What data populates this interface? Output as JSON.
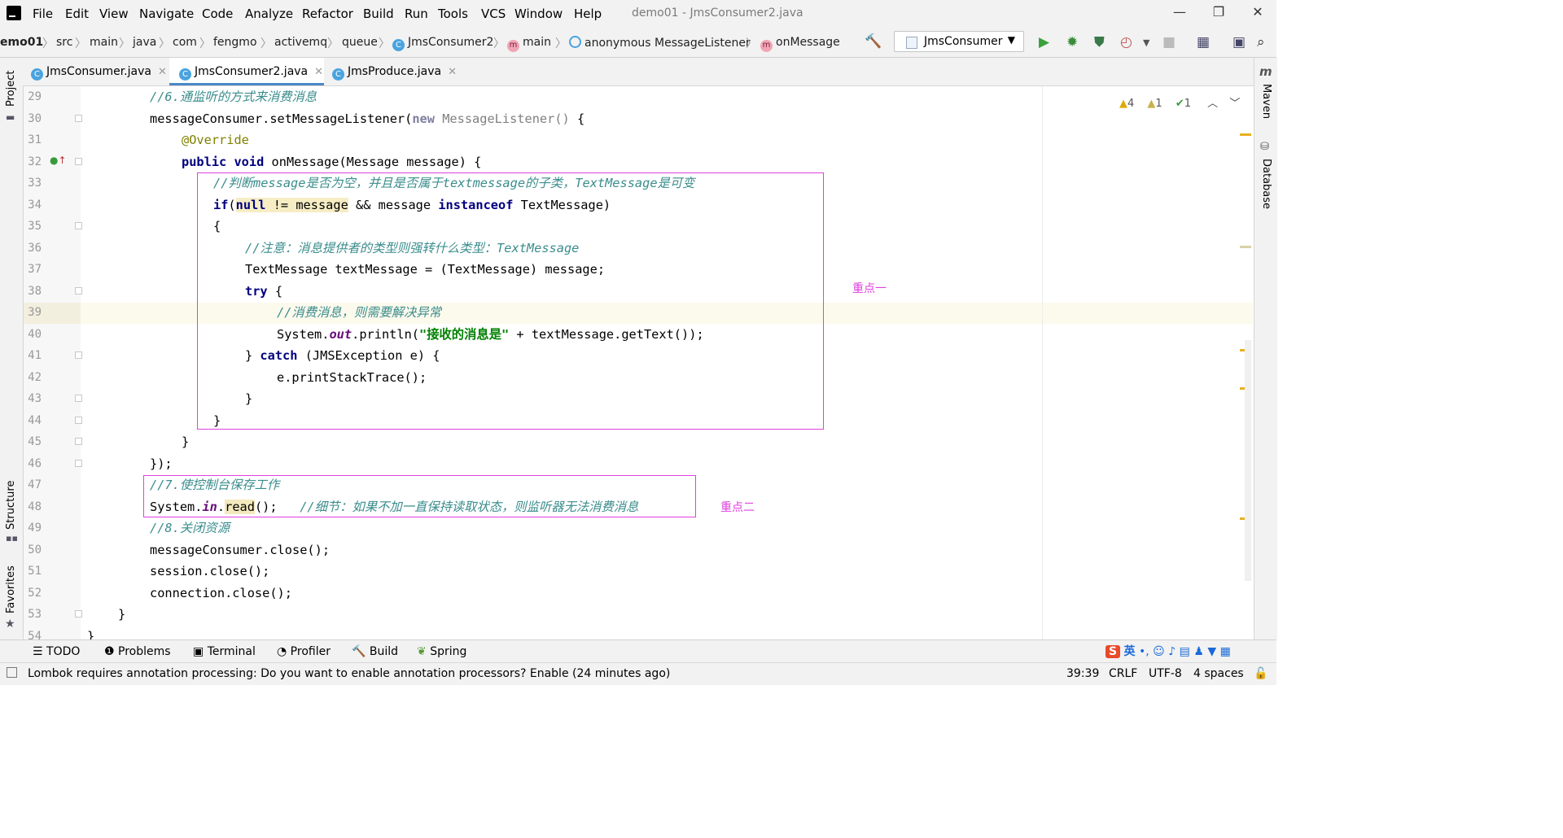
{
  "menu": [
    "File",
    "Edit",
    "View",
    "Navigate",
    "Code",
    "Analyze",
    "Refactor",
    "Build",
    "Run",
    "Tools",
    "VCS",
    "Window",
    "Help"
  ],
  "window_title": "demo01 - JmsConsumer2.java",
  "window_controls": {
    "minimize": "—",
    "maximize": "❐",
    "close": "✕"
  },
  "breadcrumbs": {
    "project": "emo01",
    "src": "src",
    "main": "main",
    "java": "java",
    "com": "com",
    "fengmo": "fengmo",
    "activemq": "activemq",
    "queue": "queue",
    "class": "JmsConsumer2",
    "method_main": "main",
    "listener": "anonymous MessageListener",
    "method_on": "onMessage"
  },
  "icons": {
    "class_letter": "C",
    "method_letter": "m"
  },
  "run_config": {
    "label": "JmsConsumer"
  },
  "tabs": [
    {
      "label": "JmsConsumer.java",
      "active": false
    },
    {
      "label": "JmsConsumer2.java",
      "active": true
    },
    {
      "label": "JmsProduce.java",
      "active": false
    }
  ],
  "left_panels": {
    "project": "Project",
    "structure": "Structure",
    "favorites": "Favorites"
  },
  "right_panels": {
    "maven": "Maven",
    "database": "Database"
  },
  "inspections": {
    "warnings": "4",
    "weak_warnings": "1",
    "typos": "1"
  },
  "lines": {
    "n29": "29",
    "n30": "30",
    "n31": "31",
    "n32": "32",
    "n33": "33",
    "n34": "34",
    "n35": "35",
    "n36": "36",
    "n37": "37",
    "n38": "38",
    "n39": "39",
    "n40": "40",
    "n41": "41",
    "n42": "42",
    "n43": "43",
    "n44": "44",
    "n45": "45",
    "n46": "46",
    "n47": "47",
    "n48": "48",
    "n49": "49",
    "n50": "50",
    "n51": "51",
    "n52": "52",
    "n53": "53",
    "n54": "54"
  },
  "code": {
    "l29": "//6.通监听的方式来消费消息",
    "l30a": "messageConsumer.setMessageListener(",
    "l30new": "new",
    "l30b": " MessageListener() ",
    "l30c": "{",
    "l31": "@Override",
    "l32kw": "public void",
    "l32b": " onMessage(Message message) {",
    "l33": "//判断message是否为空，并且是否属于textmessage的子类，TextMessage是可变",
    "l34if": "if",
    "l34p": "(",
    "l34null": "null",
    "l34ne": " != message",
    "l34and": " && message ",
    "l34inst": "instanceof",
    "l34end": " TextMessage)",
    "l35": "{",
    "l36": "//注意：消息提供者的类型则强转什么类型：TextMessage",
    "l37": "TextMessage textMessage = (TextMessage) message;",
    "l38try": "try",
    "l38b": " {",
    "l39": "//消费消息，则需要解决异常",
    "l40a": "System.",
    "l40out": "out",
    "l40b": ".println(",
    "l40str": "\"接收的消息是\"",
    "l40c": " + textMessage.getText());",
    "l41a": "} ",
    "l41catch": "catch",
    "l41b": " (JMSException e) {",
    "l42": "e.printStackTrace();",
    "l43": "}",
    "l44": "}",
    "l45": "}",
    "l46": "});",
    "l47": "//7.使控制台保存工作",
    "l48a": "System.",
    "l48in": "in",
    "l48b": ".",
    "l48read": "read",
    "l48c": "();   ",
    "l48cm": "//细节：如果不加一直保持读取状态，则监听器无法消费消息",
    "l49": "//8.关闭资源",
    "l50": "messageConsumer.close();",
    "l51": "session.close();",
    "l52": "connection.close();",
    "l53": "}",
    "l54": "}"
  },
  "annotations": {
    "key1": "重点一",
    "key2": "重点二"
  },
  "bottom_tools": {
    "todo": "TODO",
    "problems": "Problems",
    "terminal": "Terminal",
    "profiler": "Profiler",
    "build": "Build",
    "spring": "Spring"
  },
  "status": {
    "message": "Lombok requires annotation processing: Do you want to enable annotation processors? Enable (24 minutes ago)",
    "position": "39:39",
    "line_sep": "CRLF",
    "encoding": "UTF-8",
    "indent": "4 spaces"
  },
  "ime": {
    "lang": "英"
  },
  "colors": {
    "keyword": "#000080",
    "comment": "#3a8c8c",
    "annotation": "#808000",
    "string": "#008000",
    "highlight_box": "#e040e0",
    "accent": "#4a88c7"
  }
}
